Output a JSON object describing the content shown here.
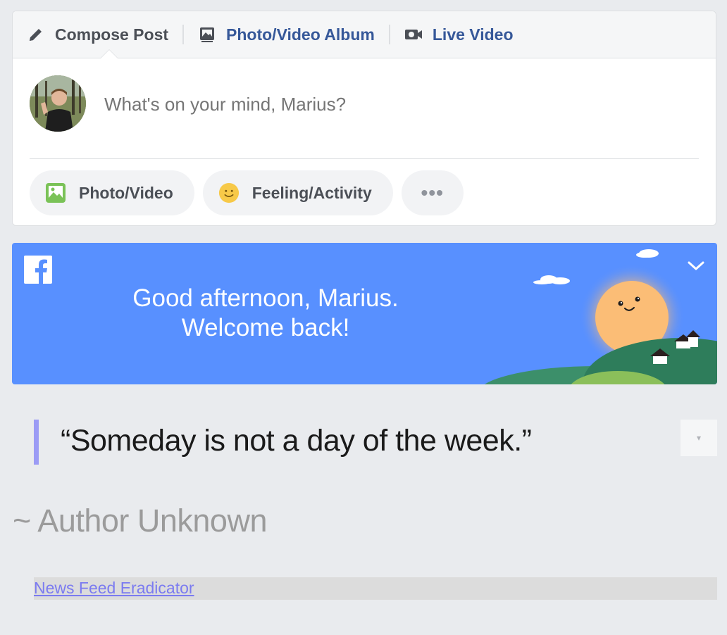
{
  "composer": {
    "tabs": [
      {
        "label": "Compose Post",
        "icon": "pencil-icon"
      },
      {
        "label": "Photo/Video Album",
        "icon": "photo-album-icon"
      },
      {
        "label": "Live Video",
        "icon": "video-camera-icon"
      }
    ],
    "placeholder": "What's on your mind, Marius?",
    "actions": [
      {
        "label": "Photo/Video",
        "icon": "photo-icon"
      },
      {
        "label": "Feeling/Activity",
        "icon": "smiley-icon"
      },
      {
        "label": "•••",
        "icon": "more-icon"
      }
    ]
  },
  "banner": {
    "line1": "Good afternoon, Marius.",
    "line2": "Welcome back!",
    "colors": {
      "background": "#5890ff",
      "sun": "#fbbd76",
      "hill_dark": "#2e7d5b",
      "hill_light": "#8bbf5a"
    }
  },
  "quote": {
    "text": "“Someday is not a day of the week.”",
    "author": "~ Author Unknown",
    "dropdown": "▾"
  },
  "footer": {
    "link": "News Feed Eradicator"
  },
  "colors": {
    "page_bg": "#e9ebee",
    "link_blue": "#365899",
    "quote_accent": "#9b9bf5"
  }
}
